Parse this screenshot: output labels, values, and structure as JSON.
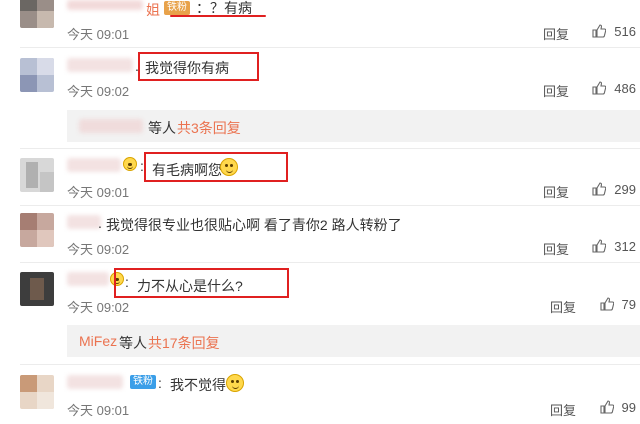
{
  "comments": [
    {
      "text": "：？有病",
      "time": "今天 09:01",
      "reply": "回复",
      "likes": "516"
    },
    {
      "text": "我觉得你有病",
      "time": "今天 09:02",
      "reply": "回复",
      "likes": "486"
    },
    {
      "text": "有毛病啊您",
      "time": "今天 09:01",
      "reply": "回复",
      "likes": "299"
    },
    {
      "text": "我觉得很专业也很贴心啊 看了青你2 路人转粉了",
      "time": "今天 09:02",
      "reply": "回复",
      "likes": "312"
    },
    {
      "text": "力不从心是什么?",
      "time": "今天 09:02",
      "reply": "回复",
      "likes": "79"
    },
    {
      "text": "我不觉得",
      "time": "今天 09:01",
      "reply": "回复",
      "likes": "99"
    }
  ],
  "fragments": {
    "partial_name": "姐"
  },
  "replies": [
    {
      "user": "",
      "mid": "等人",
      "count_link": "共3条回复"
    },
    {
      "user": "MiFez",
      "mid": "等人",
      "count_link": "共17条回复"
    }
  ],
  "badges": {
    "tiefen": "铁粉"
  },
  "colors": {
    "highlight": "#e02020",
    "link": "#eb7350",
    "badge": "#3a9ee8"
  }
}
